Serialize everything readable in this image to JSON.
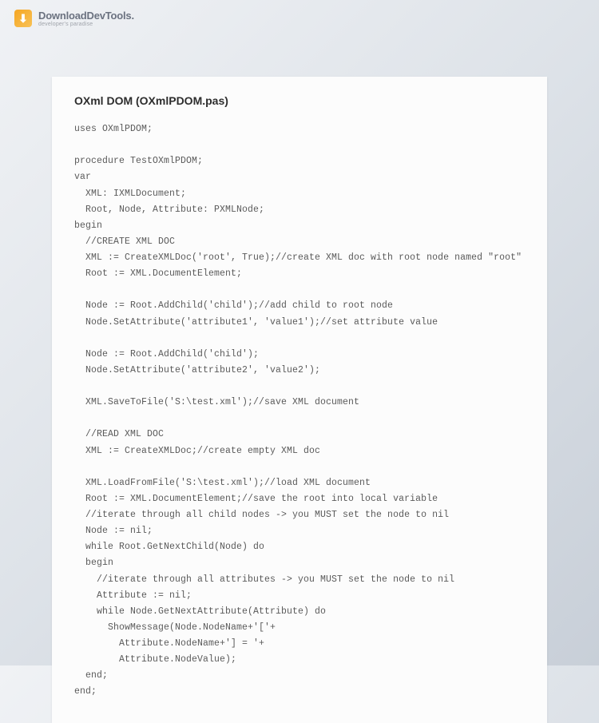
{
  "header": {
    "logo_glyph": "⬇",
    "brand_text": "DownloadDevTools.",
    "tagline": "developer's paradise"
  },
  "card": {
    "title": "OXml DOM (OXmlPDOM.pas)",
    "code": "uses OXmlPDOM;\n\nprocedure TestOXmlPDOM;\nvar\n  XML: IXMLDocument;\n  Root, Node, Attribute: PXMLNode;\nbegin\n  //CREATE XML DOC\n  XML := CreateXMLDoc('root', True);//create XML doc with root node named \"root\"\n  Root := XML.DocumentElement;\n\n  Node := Root.AddChild('child');//add child to root node\n  Node.SetAttribute('attribute1', 'value1');//set attribute value\n\n  Node := Root.AddChild('child');\n  Node.SetAttribute('attribute2', 'value2');\n\n  XML.SaveToFile('S:\\test.xml');//save XML document\n\n  //READ XML DOC\n  XML := CreateXMLDoc;//create empty XML doc\n\n  XML.LoadFromFile('S:\\test.xml');//load XML document\n  Root := XML.DocumentElement;//save the root into local variable\n  //iterate through all child nodes -> you MUST set the node to nil\n  Node := nil;\n  while Root.GetNextChild(Node) do\n  begin\n    //iterate through all attributes -> you MUST set the node to nil\n    Attribute := nil;\n    while Node.GetNextAttribute(Attribute) do\n      ShowMessage(Node.NodeName+'['+\n        Attribute.NodeName+'] = '+\n        Attribute.NodeValue);\n  end;\nend;"
  }
}
